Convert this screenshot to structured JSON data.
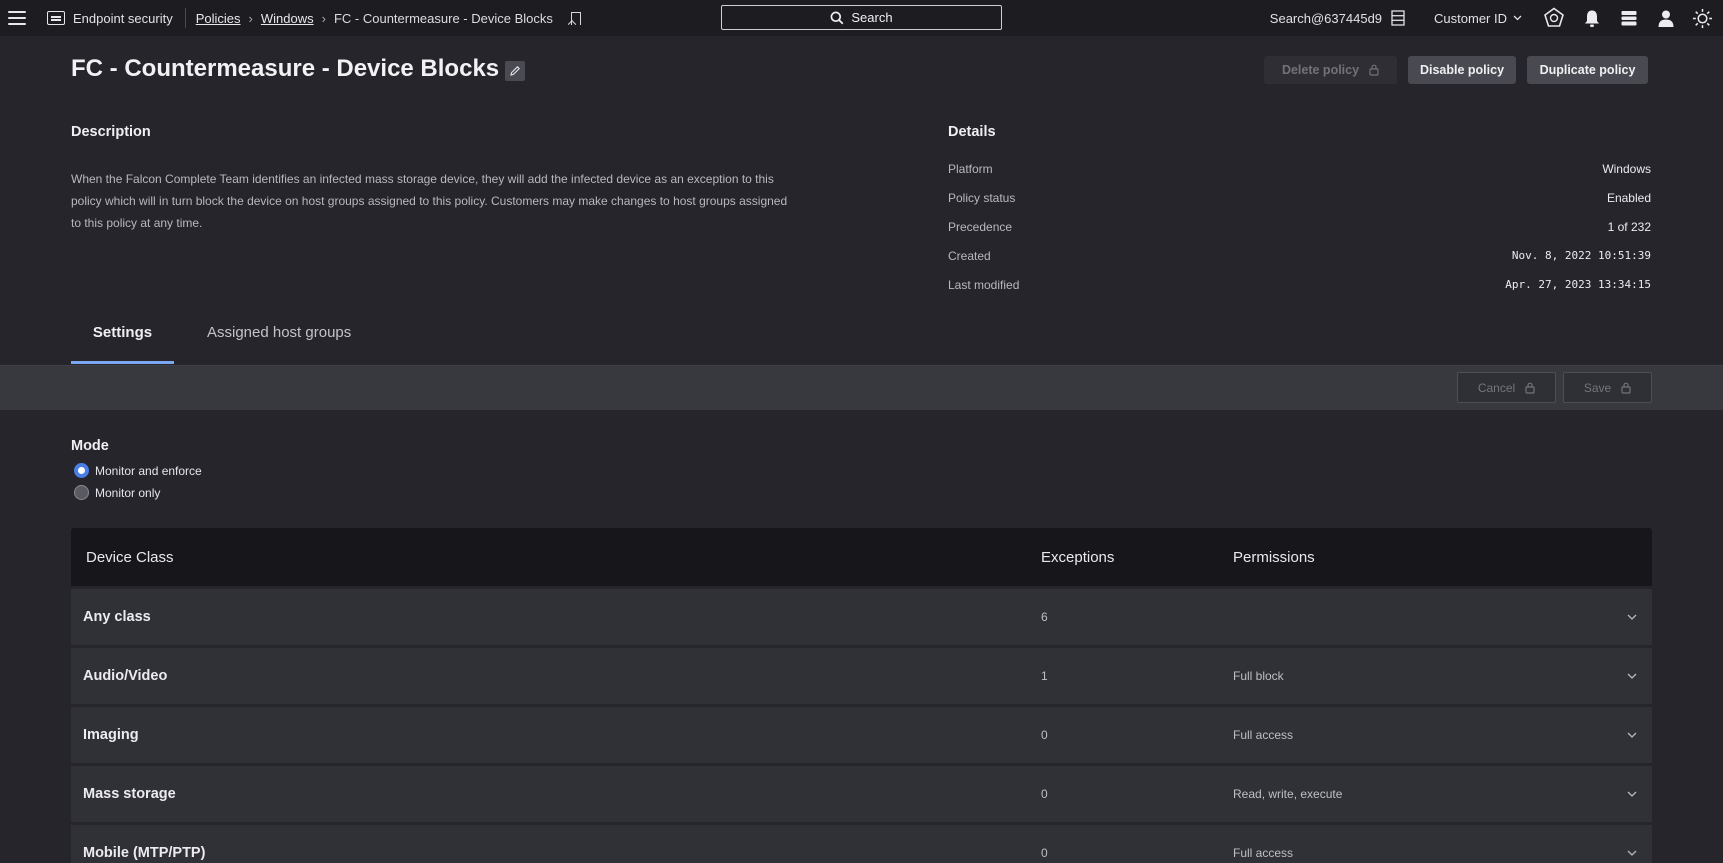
{
  "topbar": {
    "app_name": "Endpoint security",
    "breadcrumb": [
      "Policies",
      "Windows"
    ],
    "current_page": "FC - Countermeasure - Device Blocks",
    "search_label": "Search",
    "account": "Search@637445d9",
    "customer_id_label": "Customer ID"
  },
  "header": {
    "title": "FC - Countermeasure - Device Blocks",
    "delete_label": "Delete policy",
    "disable_label": "Disable policy",
    "duplicate_label": "Duplicate policy"
  },
  "description": {
    "heading": "Description",
    "text": "When the Falcon Complete Team identifies an infected mass storage device, they will add the infected device as an exception to this policy which will in turn block the device on host groups assigned to this policy. Customers may make changes to host groups assigned to this policy at any time."
  },
  "details": {
    "heading": "Details",
    "rows": [
      {
        "label": "Platform",
        "value": "Windows"
      },
      {
        "label": "Policy status",
        "value": "Enabled"
      },
      {
        "label": "Precedence",
        "value": "1 of 232"
      },
      {
        "label": "Created",
        "value": "Nov. 8, 2022 10:51:39"
      },
      {
        "label": "Last modified",
        "value": "Apr. 27, 2023 13:34:15"
      }
    ]
  },
  "tabs": [
    {
      "label": "Settings",
      "active": true
    },
    {
      "label": "Assigned host groups",
      "active": false
    }
  ],
  "actions": {
    "cancel_label": "Cancel",
    "save_label": "Save"
  },
  "mode": {
    "label": "Mode",
    "options": [
      {
        "label": "Monitor and enforce",
        "selected": true
      },
      {
        "label": "Monitor only",
        "selected": false
      }
    ]
  },
  "table": {
    "headers": [
      "Device Class",
      "Exceptions",
      "Permissions"
    ],
    "rows": [
      {
        "class": "Any class",
        "exceptions": "6",
        "permissions": ""
      },
      {
        "class": "Audio/Video",
        "exceptions": "1",
        "permissions": "Full block"
      },
      {
        "class": "Imaging",
        "exceptions": "0",
        "permissions": "Full access"
      },
      {
        "class": "Mass storage",
        "exceptions": "0",
        "permissions": "Read, write, execute"
      },
      {
        "class": "Mobile (MTP/PTP)",
        "exceptions": "0",
        "permissions": "Full access"
      }
    ]
  },
  "colors": {
    "background": "#25252b",
    "topbar": "#1c1c21",
    "accent": "#7aa6f2",
    "radio_selected": "#4a7ee6"
  }
}
